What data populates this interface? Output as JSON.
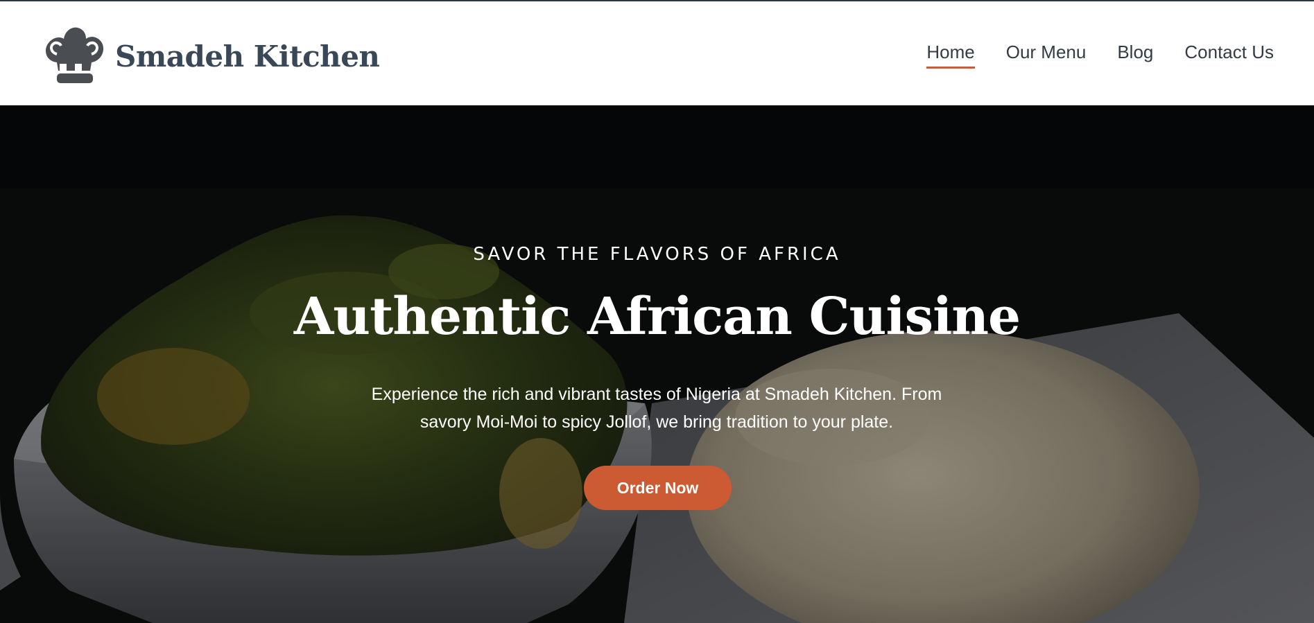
{
  "brand": {
    "name": "Smadeh Kitchen",
    "logo_icon": "chef-hat-icon"
  },
  "nav": {
    "items": [
      {
        "label": "Home",
        "active": true
      },
      {
        "label": "Our Menu",
        "active": false
      },
      {
        "label": "Blog",
        "active": false
      },
      {
        "label": "Contact Us",
        "active": false
      }
    ]
  },
  "hero": {
    "eyebrow": "SAVOR THE FLAVORS OF AFRICA",
    "title": "Authentic African Cuisine",
    "description": "Experience the rich and vibrant tastes of Nigeria at Smadeh Kitchen. From savory Moi-Moi to spicy Jollof, we bring tradition to your plate.",
    "cta_label": "Order Now"
  },
  "colors": {
    "accent": "#cc5a33",
    "brand_text": "#3a4756",
    "nav_text": "#333b44",
    "hero_text": "#ffffff"
  }
}
